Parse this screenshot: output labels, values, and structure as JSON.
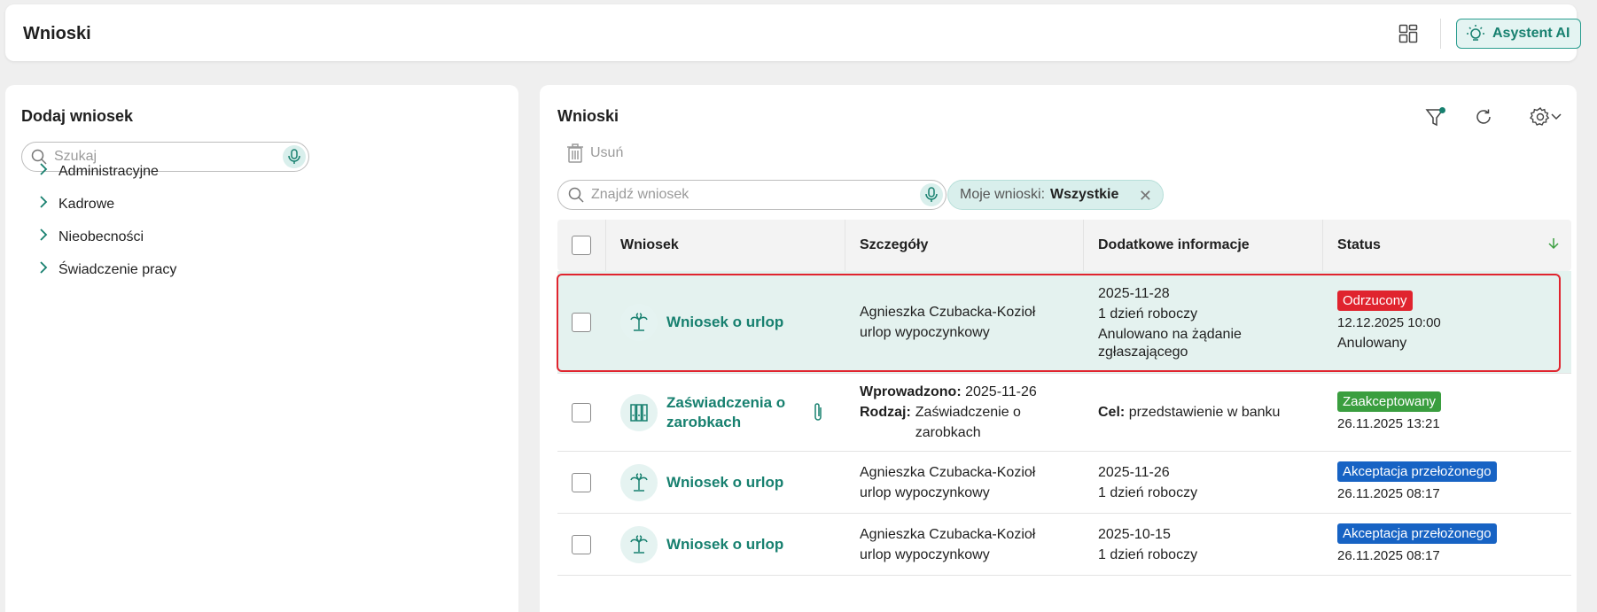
{
  "header": {
    "title": "Wnioski",
    "ai_button_label": "Asystent AI"
  },
  "left_panel": {
    "title": "Dodaj wniosek",
    "search_placeholder": "Szukaj",
    "categories": [
      "Administracyjne",
      "Kadrowe",
      "Nieobecności",
      "Świadczenie pracy"
    ]
  },
  "right_panel": {
    "title": "Wnioski",
    "delete_label": "Usuń",
    "search_placeholder": "Znajdź wniosek",
    "filter_chip": {
      "label": "Moje wnioski:",
      "value": "Wszystkie"
    },
    "columns": [
      "Wniosek",
      "Szczegóły",
      "Dodatkowe informacje",
      "Status"
    ],
    "rows": [
      {
        "type": "Wniosek o urlop",
        "icon": "palm-tree-icon",
        "details": [
          "Agnieszka Czubacka-Kozioł",
          "urlop wypoczynkowy"
        ],
        "extra": [
          "2025-11-28",
          "1 dzień roboczy",
          "Anulowano na żądanie",
          "zgłaszającego"
        ],
        "status": "Odrzucony",
        "status_color": "#e0242e",
        "status_date": "12.12.2025 10:00",
        "status_note": "Anulowany"
      },
      {
        "type_line1": "Zaświadczenia o",
        "type_line2": "zarobkach",
        "icon": "binders-icon",
        "attachment_icon": "paperclip-icon",
        "entered_label": "Wprowadzono:",
        "entered_value": "2025-11-26",
        "kind_label": "Rodzaj:",
        "kind_value_line1": "Zaświadczenie o",
        "kind_value_line2": "zarobkach",
        "purpose_label": "Cel:",
        "purpose_value": "przedstawienie w banku",
        "status": "Zaakceptowany",
        "status_color": "#3a9e3f",
        "status_date": "26.11.2025 13:21"
      },
      {
        "type": "Wniosek o urlop",
        "icon": "palm-tree-icon",
        "details": [
          "Agnieszka Czubacka-Kozioł",
          "urlop wypoczynkowy"
        ],
        "extra": [
          "2025-11-26",
          "1 dzień roboczy"
        ],
        "status": "Akceptacja przełożonego",
        "status_color": "#1763c4",
        "status_date": "26.11.2025 08:17"
      },
      {
        "type": "Wniosek o urlop",
        "icon": "palm-tree-icon",
        "details": [
          "Agnieszka Czubacka-Kozioł",
          "urlop wypoczynkowy"
        ],
        "extra": [
          "2025-10-15",
          "1 dzień roboczy"
        ],
        "status": "Akceptacja przełożonego",
        "status_color": "#1763c4",
        "status_date": "26.11.2025 08:17"
      }
    ]
  }
}
